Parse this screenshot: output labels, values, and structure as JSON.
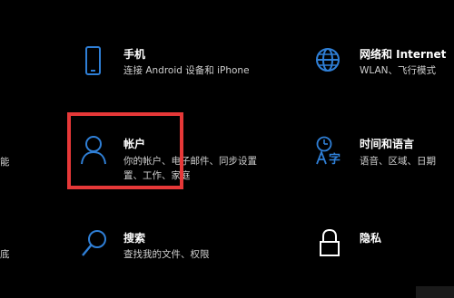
{
  "colors": {
    "background": "#000000",
    "accent": "#2f7fd6",
    "highlight": "#e63838",
    "title": "#ffffff",
    "description": "#cfcfcf"
  },
  "left_edge": {
    "line1": "能",
    "line2": "底"
  },
  "tiles": {
    "phone": {
      "icon": "phone-icon",
      "title": "手机",
      "desc": "连接 Android 设备和 iPhone"
    },
    "network": {
      "icon": "globe-icon",
      "title": "网络和 Internet",
      "desc": "WLAN、飞行模式"
    },
    "accounts": {
      "icon": "person-icon",
      "title": "帐户",
      "desc_line1": "你的帐户、电子邮件、同步设置",
      "desc_line2": "置、工作、家庭"
    },
    "time_language": {
      "icon": "time-language-icon",
      "title": "时间和语言",
      "desc": "语音、区域、日期"
    },
    "search": {
      "icon": "search-icon",
      "title": "搜索",
      "desc": "查找我的文件、权限"
    },
    "privacy": {
      "icon": "lock-icon",
      "title": "隐私",
      "desc": ""
    }
  }
}
